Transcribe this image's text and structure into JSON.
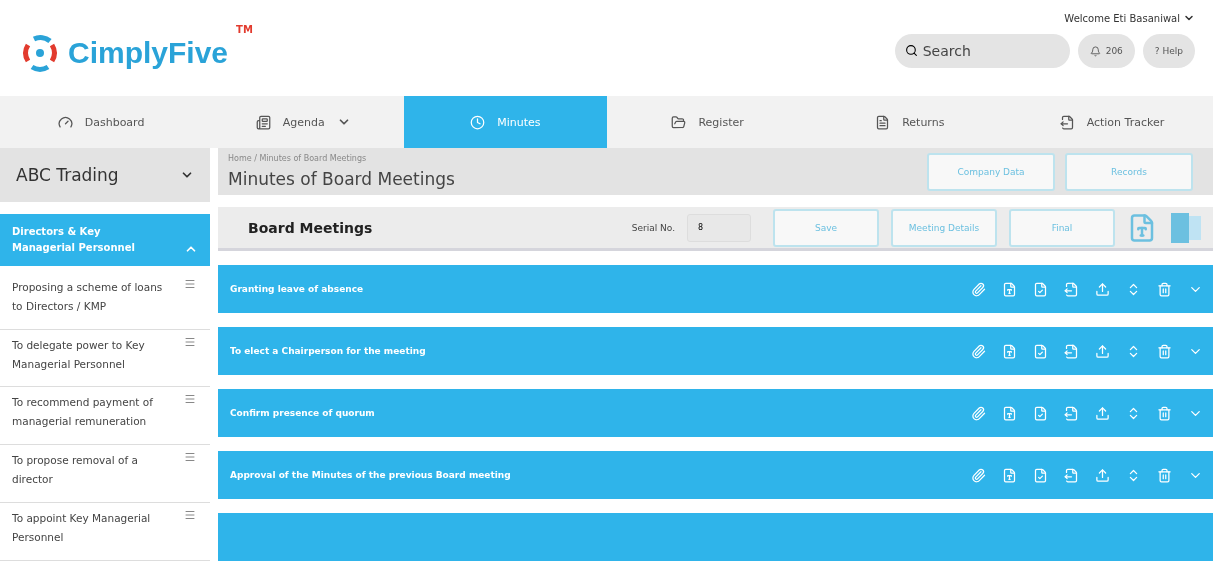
{
  "logo": {
    "name": "CimplyFive",
    "mark": "TM"
  },
  "user": {
    "welcome": "Welcome Eti Basaniwal"
  },
  "search": {
    "placeholder": "Search"
  },
  "notifications": {
    "count": "206"
  },
  "help": {
    "label": "? Help"
  },
  "nav": [
    {
      "label": "Dashboard",
      "selected": false,
      "dropdown": false
    },
    {
      "label": "Agenda",
      "selected": false,
      "dropdown": true
    },
    {
      "label": "Minutes",
      "selected": true,
      "dropdown": false
    },
    {
      "label": "Register",
      "selected": false,
      "dropdown": false
    },
    {
      "label": "Returns",
      "selected": false,
      "dropdown": false
    },
    {
      "label": "Action Tracker",
      "selected": false,
      "dropdown": false
    }
  ],
  "company": {
    "name": "ABC Trading"
  },
  "breadcrumb": "Home / Minutes of Board Meetings",
  "page_title": "Minutes of Board Meetings",
  "header_buttons": [
    "Company Data",
    "Records"
  ],
  "sidebar": {
    "section": {
      "label": "Directors & Key Managerial Personnel",
      "expanded": true
    },
    "items": [
      {
        "label": "Proposing a scheme of loans to Directors / KMP"
      },
      {
        "label": "To delegate power to Key Managerial Personnel"
      },
      {
        "label": "To recommend payment of managerial remuneration"
      },
      {
        "label": "To propose removal of a director"
      },
      {
        "label": "To appoint Key Managerial Personnel"
      }
    ]
  },
  "toolbar": {
    "title": "Board Meetings",
    "serial_label": "Serial No.",
    "serial_value": "8",
    "buttons": [
      "Save",
      "Meeting Details",
      "Final"
    ]
  },
  "agenda_items": [
    {
      "title": "Granting leave of absence"
    },
    {
      "title": "To elect a Chairperson for the meeting"
    },
    {
      "title": "Confirm presence of quorum"
    },
    {
      "title": "Approval of the Minutes of the previous Board meeting"
    }
  ]
}
